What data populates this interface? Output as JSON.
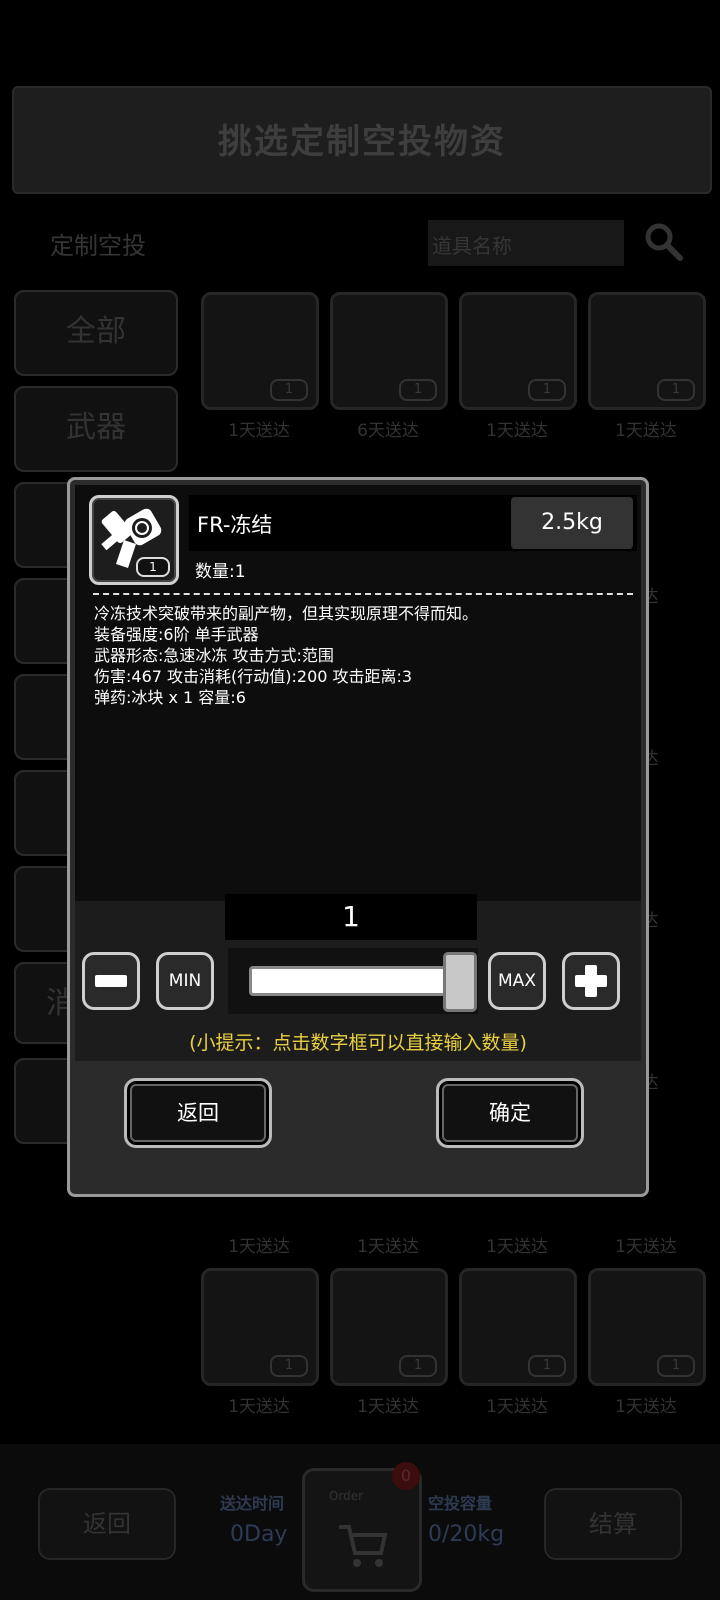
{
  "background": {
    "header_title": "挑选定制空投物资",
    "tab_label": "定制空投",
    "search_placeholder": "道具名称",
    "side_categories": [
      "全部",
      "武器",
      "",
      "",
      "",
      "",
      "",
      "消",
      ""
    ],
    "delivery_labels": [
      "1天送达",
      "6天送达",
      "1天送达",
      "1天送达"
    ],
    "delivery_labels_row6": [
      "1天送达",
      "1天送达",
      "1天送达",
      "1天送达"
    ],
    "delivery_labels_row7": [
      "1天送达",
      "1天送达",
      "1天送达",
      "1天送达"
    ],
    "right_col_labels": [
      "达",
      "达",
      "达",
      "达",
      "达"
    ],
    "card_count": "1",
    "bottom": {
      "back_label": "返回",
      "delivery_time_label": "送达时间",
      "delivery_time_value": "0Day",
      "cart_badge": "0",
      "cart_tag": "Order",
      "capacity_label": "空投容量",
      "capacity_value": "0/20kg",
      "checkout_label": "结算"
    }
  },
  "modal": {
    "item_name": "FR-冻结",
    "weight": "2.5kg",
    "quantity_label": "数量:1",
    "icon_count": "1",
    "description": "冷冻技术突破带来的副产物，但其实现原理不得而知。\n装备强度:6阶 单手武器\n武器形态:急速冰冻 攻击方式:范围\n 伤害:467 攻击消耗(行动值):200 攻击距离:3\n弹药:冰块 x 1 容量:6",
    "number_value": "1",
    "min_label": "MIN",
    "max_label": "MAX",
    "slider_fraction": 1.0,
    "hint": "(小提示：点击数字框可以直接输入数量)",
    "back_label": "返回",
    "confirm_label": "确定"
  }
}
